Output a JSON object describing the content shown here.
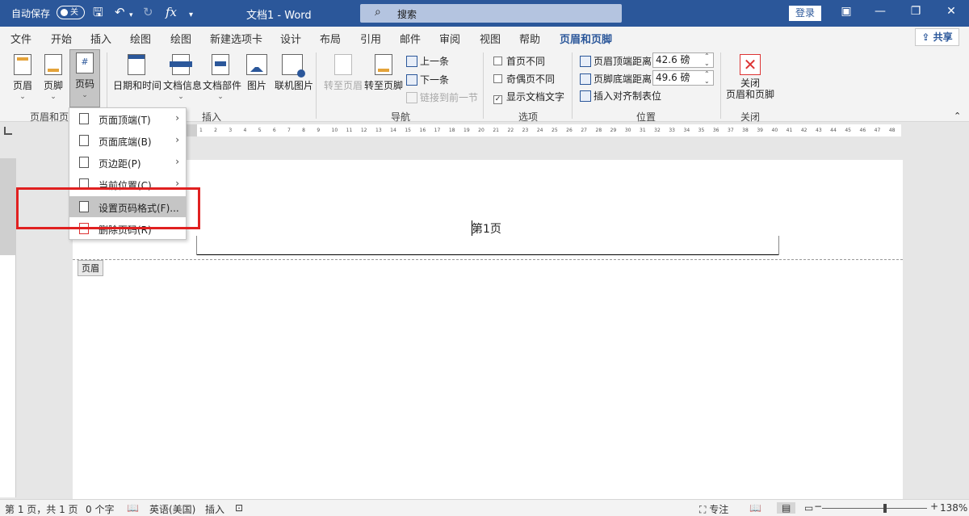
{
  "titlebar": {
    "autosave_label": "自动保存",
    "autosave_state": "关",
    "doc_title": "文档1  -  Word",
    "search_placeholder": "搜索",
    "login": "登录"
  },
  "tabs": [
    "文件",
    "开始",
    "插入",
    "绘图",
    "绘图",
    "新建选项卡",
    "设计",
    "布局",
    "引用",
    "邮件",
    "审阅",
    "视图",
    "帮助",
    "页眉和页脚"
  ],
  "active_tab": "页眉和页脚",
  "share": "共享",
  "ribbon": {
    "header_footer": {
      "header": "页眉",
      "footer": "页脚",
      "page_number": "页码",
      "group_label": "页眉和页脚"
    },
    "insert": {
      "date_time": "日期和时间",
      "doc_info": "文档信息",
      "doc_parts": "文档部件",
      "picture": "图片",
      "online_picture": "联机图片",
      "group_label": "插入"
    },
    "navigation": {
      "goto_header": "转至页眉",
      "goto_footer": "转至页脚",
      "previous": "上一条",
      "next": "下一条",
      "link_previous": "链接到前一节",
      "group_label": "导航"
    },
    "options": {
      "different_first": "首页不同",
      "different_odd_even": "奇偶页不同",
      "show_doc_text": "显示文档文字",
      "group_label": "选项"
    },
    "position": {
      "header_from_top_label": "页眉顶端距离:",
      "header_from_top_value": "42.6 磅",
      "footer_from_bottom_label": "页脚底端距离:",
      "footer_from_bottom_value": "49.6 磅",
      "insert_align_tab": "插入对齐制表位",
      "group_label": "位置"
    },
    "close": {
      "close_label_1": "关闭",
      "close_label_2": "页眉和页脚",
      "group_label": "关闭"
    }
  },
  "dropdown": {
    "items": [
      {
        "label": "页面顶端(T)",
        "has_submenu": true
      },
      {
        "label": "页面底端(B)",
        "has_submenu": true
      },
      {
        "label": "页边距(P)",
        "has_submenu": true
      },
      {
        "label": "当前位置(C)",
        "has_submenu": true
      },
      {
        "label": "设置页码格式(F)...",
        "has_submenu": false
      },
      {
        "label": "删除页码(R)",
        "has_submenu": false
      }
    ]
  },
  "ruler": {
    "numbers": [
      "1",
      "2",
      "3",
      "4",
      "5",
      "6",
      "7",
      "8",
      "9",
      "10",
      "11",
      "12",
      "13",
      "14",
      "15",
      "16",
      "17",
      "18",
      "19",
      "20",
      "21",
      "22",
      "23",
      "24",
      "25",
      "26",
      "27",
      "28",
      "29",
      "30",
      "31",
      "32",
      "33",
      "34",
      "35",
      "36",
      "37",
      "38",
      "39",
      "40",
      "41",
      "42",
      "43",
      "44",
      "45",
      "46",
      "47",
      "48"
    ]
  },
  "document": {
    "header_text": "第1页",
    "header_tag": "页眉"
  },
  "statusbar": {
    "page_info": "第 1 页，共 1 页",
    "word_count": "0 个字",
    "language": "英语(美国)",
    "insert_mode": "插入",
    "focus": "专注",
    "zoom": "138%"
  }
}
